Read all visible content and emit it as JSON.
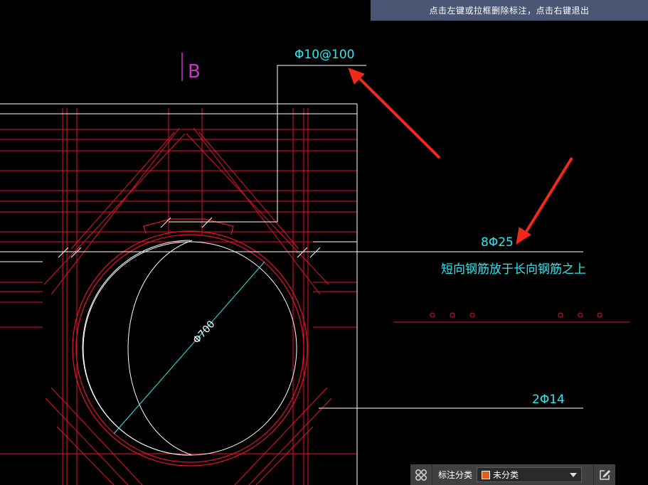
{
  "hint": "点击左键或拉框删除标注，点击右键退出",
  "labels": {
    "section_mark": "B",
    "stirrup": "Φ10@100",
    "long_bar": "8Φ25",
    "note": "短向钢筋放于长向钢筋之上",
    "bottom_bar": "2Φ14",
    "diameter": "Φ700"
  },
  "toolbar": {
    "category_label": "标注分类",
    "selected_category": "未分类",
    "category_color": "#e85a1a",
    "icons": [
      "layers-icon",
      "edit-icon"
    ]
  },
  "colors": {
    "background": "#000000",
    "rebar": "#e8102a",
    "outline": "#ffffff",
    "annotation": "#2ee8ee",
    "section": "#cc33cc",
    "arrow": "#ee2a1a"
  }
}
